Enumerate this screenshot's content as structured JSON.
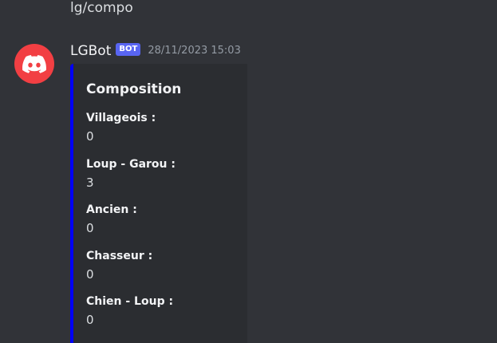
{
  "previous_message": {
    "text": "lg/compo"
  },
  "message": {
    "avatar_icon": "discord-logo-icon",
    "avatar_color": "#f23f43",
    "username": "LGBot",
    "bot_tag": "BOT",
    "timestamp": "28/11/2023 15:03"
  },
  "embed": {
    "accent_color": "#0000f5",
    "title": "Composition",
    "fields": [
      {
        "name": "Villageois :",
        "value": "0"
      },
      {
        "name": "Loup - Garou :",
        "value": "3"
      },
      {
        "name": "Ancien :",
        "value": "0"
      },
      {
        "name": "Chasseur :",
        "value": "0"
      },
      {
        "name": "Chien - Loup :",
        "value": "0"
      }
    ]
  }
}
